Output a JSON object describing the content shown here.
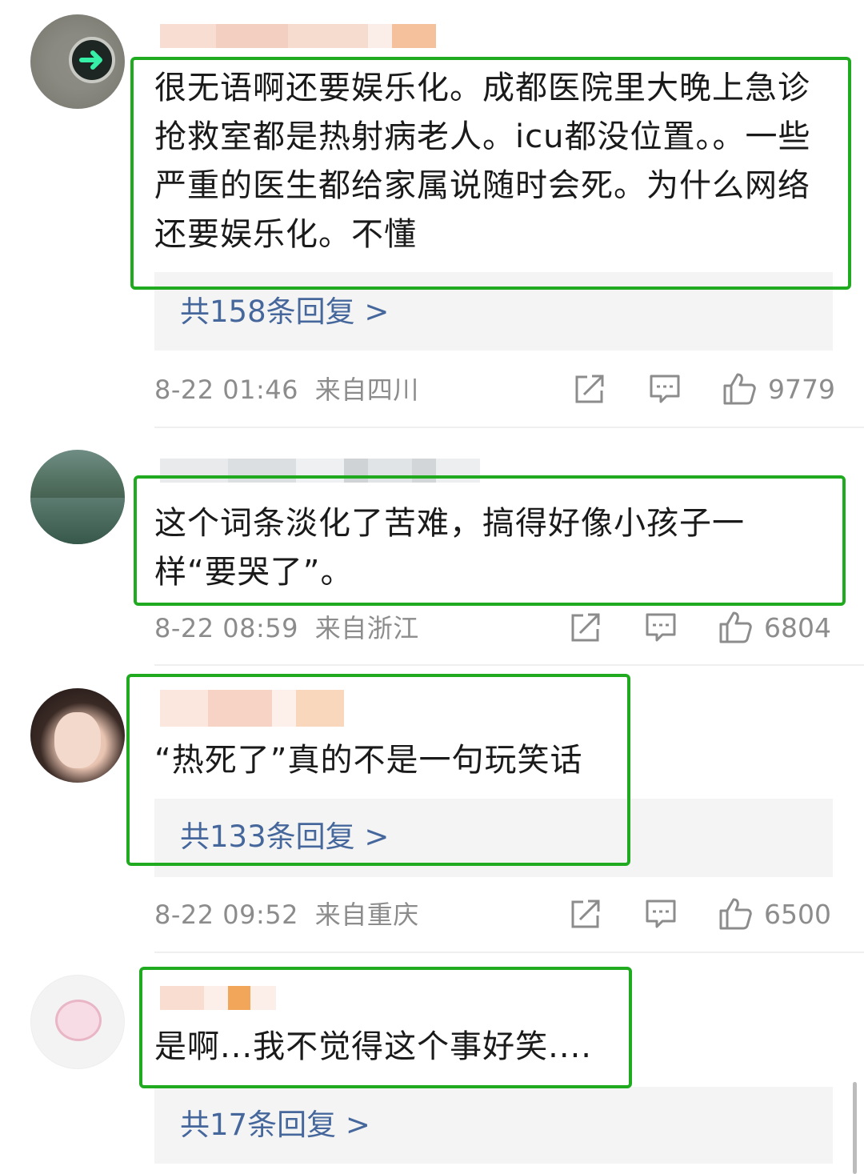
{
  "comments": [
    {
      "text": "很无语啊还要娱乐化。成都医院里大晚上急诊抢救室都是热射病老人。icu都没位置。。一些严重的医生都给家属说随时会死。为什么网络还要娱乐化。不懂",
      "replies": "共158条回复 >",
      "time": "8-22 01:46",
      "location": "来自四川",
      "likes": "9779"
    },
    {
      "text": "这个词条淡化了苦难，搞得好像小孩子一样“要哭了”。",
      "time": "8-22 08:59",
      "location": "来自浙江",
      "likes": "6804"
    },
    {
      "text": "“热死了”真的不是一句玩笑话",
      "replies": "共133条回复 >",
      "time": "8-22 09:52",
      "location": "来自重庆",
      "likes": "6500"
    },
    {
      "text": "是啊...我不觉得这个事好笑....",
      "replies": "共17条回复 >"
    }
  ],
  "icons": {
    "share": "share-icon",
    "comment": "comment-icon",
    "like": "thumbs-up-icon"
  },
  "colors": {
    "highlight": "#1faa1f",
    "reply_link": "#46679b",
    "meta_text": "#8c8c8c"
  }
}
